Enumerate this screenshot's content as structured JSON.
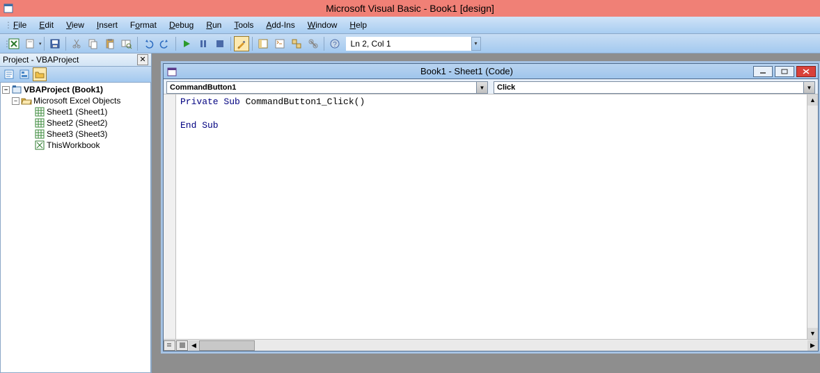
{
  "titlebar": {
    "title": "Microsoft Visual Basic - Book1 [design]"
  },
  "menubar": {
    "items": [
      {
        "label": "File",
        "u": "F"
      },
      {
        "label": "Edit",
        "u": "E"
      },
      {
        "label": "View",
        "u": "V"
      },
      {
        "label": "Insert",
        "u": "I"
      },
      {
        "label": "Format",
        "u": "o"
      },
      {
        "label": "Debug",
        "u": "D"
      },
      {
        "label": "Run",
        "u": "R"
      },
      {
        "label": "Tools",
        "u": "T"
      },
      {
        "label": "Add-Ins",
        "u": "A"
      },
      {
        "label": "Window",
        "u": "W"
      },
      {
        "label": "Help",
        "u": "H"
      }
    ]
  },
  "toolbar": {
    "position": "Ln 2, Col 1"
  },
  "project": {
    "title": "Project - VBAProject",
    "root": "VBAProject (Book1)",
    "group": "Microsoft Excel Objects",
    "items": [
      "Sheet1 (Sheet1)",
      "Sheet2 (Sheet2)",
      "Sheet3 (Sheet3)",
      "ThisWorkbook"
    ]
  },
  "codewin": {
    "title": "Book1 - Sheet1 (Code)",
    "object": "CommandButton1",
    "proc": "Click",
    "code": {
      "kw_private_sub": "Private Sub",
      "signature": " CommandButton1_Click()",
      "kw_end_sub": "End Sub"
    }
  }
}
